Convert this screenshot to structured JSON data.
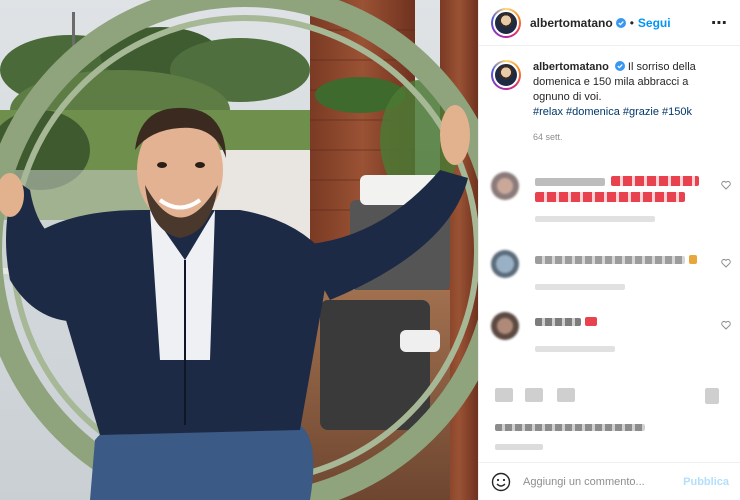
{
  "post": {
    "username": "albertomatano",
    "follow_label": "Segui",
    "more_icon": "more-horizontal-icon",
    "verified_color": "#3897f0"
  },
  "caption": {
    "username": "albertomatano",
    "text": "Il sorriso della domenica e 150 mila abbracci a ognuno di voi.",
    "hashtags": "#relax #domenica #grazie #150k",
    "age": "64 sett."
  },
  "comments": [
    {
      "blurred": true
    },
    {
      "blurred": true
    },
    {
      "blurred": true
    }
  ],
  "add_comment": {
    "placeholder": "Aggiungi un commento...",
    "publish_label": "Pubblica"
  },
  "colors": {
    "accent": "#0095f6",
    "link": "#00376b",
    "muted": "#8e8e8e"
  }
}
